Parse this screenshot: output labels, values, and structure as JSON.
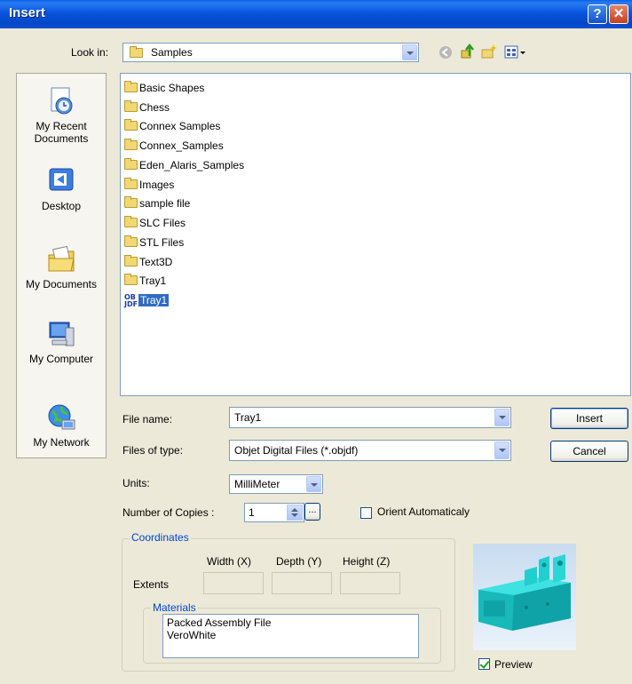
{
  "window": {
    "title": "Insert",
    "help_glyph": "?",
    "close_glyph": "✕"
  },
  "lookin": {
    "label": "Look in:",
    "value": "Samples"
  },
  "places": [
    {
      "label": "My Recent\nDocuments",
      "icon": "recent-documents-icon"
    },
    {
      "label": "Desktop",
      "icon": "desktop-icon"
    },
    {
      "label": "My Documents",
      "icon": "my-documents-icon"
    },
    {
      "label": "My Computer",
      "icon": "my-computer-icon"
    },
    {
      "label": "My Network",
      "icon": "my-network-icon"
    }
  ],
  "files": [
    {
      "name": "Basic Shapes",
      "type": "folder"
    },
    {
      "name": "Chess",
      "type": "folder"
    },
    {
      "name": "Connex Samples",
      "type": "folder"
    },
    {
      "name": "Connex_Samples",
      "type": "folder"
    },
    {
      "name": "Eden_Alaris_Samples",
      "type": "folder"
    },
    {
      "name": "Images",
      "type": "folder"
    },
    {
      "name": "sample file",
      "type": "folder"
    },
    {
      "name": "SLC Files",
      "type": "folder"
    },
    {
      "name": "STL Files",
      "type": "folder"
    },
    {
      "name": "Text3D",
      "type": "folder"
    },
    {
      "name": "Tray1",
      "type": "folder"
    },
    {
      "name": "Tray1",
      "type": "objdf",
      "selected": true,
      "icon_text": "OB\nJDF"
    }
  ],
  "filename": {
    "label": "File name:",
    "value": "Tray1"
  },
  "filetype": {
    "label": "Files of type:",
    "value": "Objet Digital Files (*.objdf)"
  },
  "buttons": {
    "insert": "Insert",
    "cancel": "Cancel"
  },
  "units": {
    "label": "Units:",
    "value": "MilliMeter"
  },
  "copies": {
    "label": "Number of Copies :",
    "value": "1",
    "browse": "..."
  },
  "orient": {
    "label": "Orient Automaticaly",
    "checked": false
  },
  "coordinates": {
    "legend": "Coordinates",
    "headers": [
      "Width (X)",
      "Depth (Y)",
      "Height (Z)"
    ],
    "row_label": "Extents"
  },
  "materials": {
    "legend": "Materials",
    "items": [
      "Packed Assembly File",
      "VeroWhite"
    ]
  },
  "preview": {
    "label": "Preview",
    "checked": true
  }
}
